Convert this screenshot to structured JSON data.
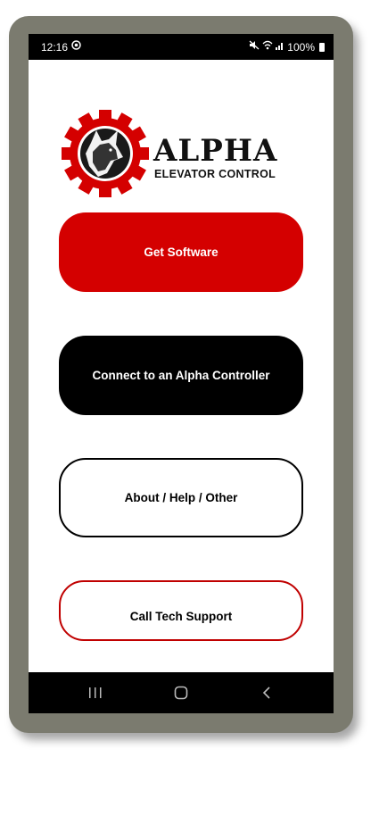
{
  "status": {
    "time": "12:16",
    "battery_text": "100%"
  },
  "logo": {
    "title": "ALPHA",
    "subtitle": "ELEVATOR CONTROL",
    "gear_color": "#d40000"
  },
  "buttons": {
    "get_software": "Get Software",
    "connect": "Connect to an Alpha Controller",
    "about": "About / Help / Other",
    "call_support": "Call Tech Support"
  },
  "nav": {
    "recents_icon": "recents-icon",
    "home_icon": "home-icon",
    "back_icon": "back-icon"
  },
  "colors": {
    "brand_red": "#d40000",
    "bezel": "#7b7b6f"
  }
}
